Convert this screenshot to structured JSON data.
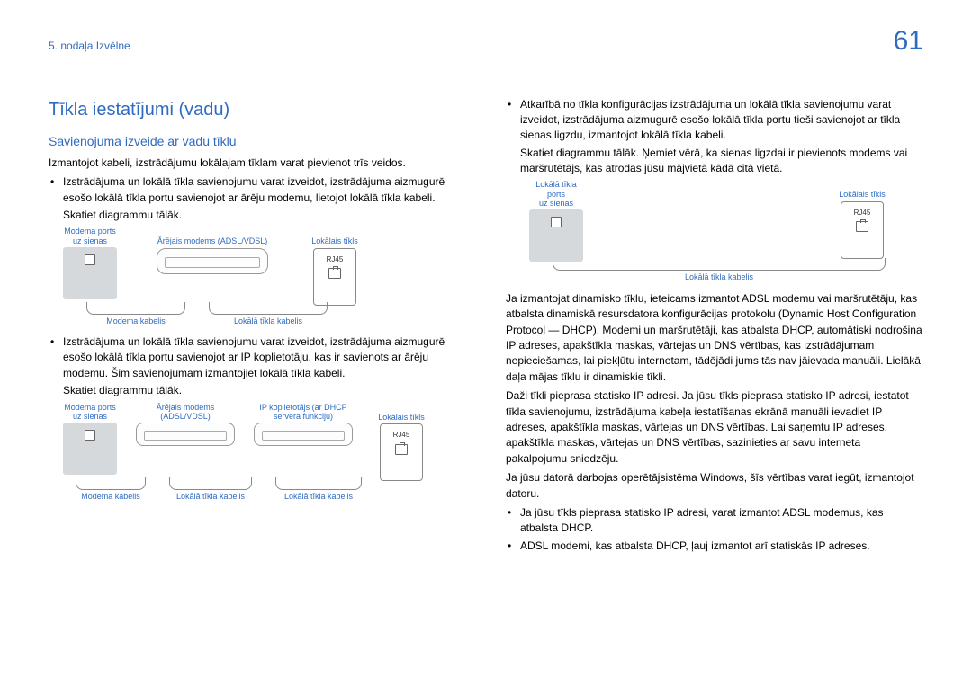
{
  "header": {
    "chapter": "5. nodaļa Izvēlne",
    "page_number": "61"
  },
  "left": {
    "title": "Tīkla iestatījumi (vadu)",
    "subtitle": "Savienojuma izveide ar vadu tīklu",
    "intro": "Izmantojot kabeli, izstrādājumu lokālajam tīklam varat pievienot trīs veidos.",
    "bullet1": "Izstrādājuma un lokālā tīkla savienojumu varat izveidot, izstrādājuma aizmugurē esošo lokālā tīkla portu savienojot ar ārēju modemu, lietojot lokālā tīkla kabeli.",
    "see1": "Skatiet diagrammu tālāk.",
    "bullet2": "Izstrādājuma un lokālā tīkla savienojumu varat izveidot, izstrādājuma aizmugurē esošo lokālā tīkla portu savienojot ar IP koplietotāju, kas ir savienots ar ārēju modemu. Šim savienojumam izmantojiet lokālā tīkla kabeli.",
    "see2": "Skatiet diagrammu tālāk."
  },
  "right": {
    "bullet3": "Atkarībā no tīkla konfigurācijas izstrādājuma un lokālā tīkla savienojumu varat izveidot, izstrādājuma aizmugurē esošo lokālā tīkla portu tieši savienojot ar tīkla sienas ligzdu, izmantojot lokālā tīkla kabeli.",
    "see3_line1": "Skatiet diagrammu tālāk. Ņemiet vērā, ka sienas ligzdai ir pievienots modems vai maršrutētājs, kas atrodas jūsu mājvietā kādā citā vietā.",
    "p1": "Ja izmantojat dinamisko tīklu, ieteicams izmantot ADSL modemu vai maršrutētāju, kas atbalsta dinamiskā resursdatora konfigurācijas protokolu (Dynamic Host Configuration Protocol — DHCP). Modemi un maršrutētāji, kas atbalsta DHCP, automātiski nodrošina IP adreses, apakštīkla maskas, vārtejas un DNS vērtības, kas izstrādājumam nepieciešamas, lai piekļūtu internetam, tādējādi jums tās nav jāievada manuāli. Lielākā daļa mājas tīklu ir dinamiskie tīkli.",
    "p2": "Daži tīkli pieprasa statisko IP adresi. Ja jūsu tīkls pieprasa statisko IP adresi, iestatot tīkla savienojumu, izstrādājuma kabeļa iestatīšanas ekrānā manuāli ievadiet IP adreses, apakštīkla maskas, vārtejas un DNS vērtības. Lai saņemtu IP adreses, apakštīkla maskas, vārtejas un DNS vērtības, sazinieties ar savu interneta pakalpojumu sniedzēju.",
    "p3": "Ja jūsu datorā darbojas operētājsistēma Windows, šīs vērtības varat iegūt, izmantojot datoru.",
    "sub_b1": "Ja jūsu tīkls pieprasa statisko IP adresi, varat izmantot ADSL modemus, kas atbalsta DHCP.",
    "sub_b2": "ADSL modemi, kas atbalsta DHCP, ļauj izmantot arī statiskās IP adreses."
  },
  "labels": {
    "modem_port_wall": "Modema ports\nuz sienas",
    "lan_port_wall": "Lokālā tīkla ports\nuz sienas",
    "ext_modem_adsl": "Ārējais modems (ADSL/VDSL)",
    "ext_modem_short": "Ārējais modems\n(ADSL/VDSL)",
    "ip_sharer": "IP koplietotājs (ar DHCP\nservera funkciju)",
    "lan": "Lokālais tīkls",
    "rj45": "RJ45",
    "modem_cable": "Modema kabelis",
    "lan_cable": "Lokālā tīkla kabelis"
  }
}
